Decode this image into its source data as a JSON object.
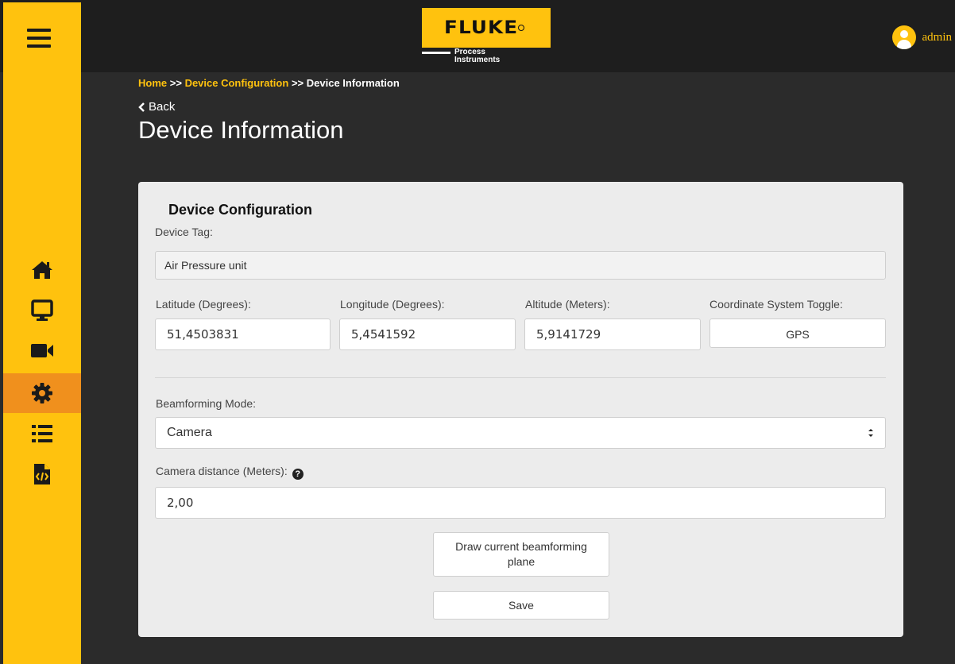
{
  "header": {
    "logo_text": "FLUKE",
    "logo_sub_line1": "Process",
    "logo_sub_line2": "Instruments",
    "user_name": "admin"
  },
  "sidebar": {
    "items": [
      {
        "icon": "home-icon"
      },
      {
        "icon": "monitor-icon"
      },
      {
        "icon": "video-camera-icon"
      },
      {
        "icon": "gear-icon",
        "active": true
      },
      {
        "icon": "list-icon"
      },
      {
        "icon": "code-file-icon"
      }
    ],
    "accent": "#ffc20e",
    "active_color": "#f0901d"
  },
  "breadcrumb": {
    "home": "Home",
    "sep1": ">>",
    "device_configuration": "Device Configuration",
    "sep2": ">>",
    "current": "Device Information"
  },
  "back_label": "Back",
  "page_title": "Device Information",
  "card": {
    "title": "Device Configuration",
    "device_tag_label": "Device Tag:",
    "device_tag_value": "Air Pressure unit",
    "latitude_label": "Latitude (Degrees):",
    "latitude_value": "51,4503831",
    "longitude_label": "Longitude (Degrees):",
    "longitude_value": "5,4541592",
    "altitude_label": "Altitude (Meters):",
    "altitude_value": "5,9141729",
    "coord_toggle_label": "Coordinate System Toggle:",
    "coord_toggle_value": "GPS",
    "beamforming_label": "Beamforming Mode:",
    "beamforming_value": "Camera",
    "camera_distance_label": "Camera distance (Meters):",
    "camera_distance_value": "2,00",
    "draw_button_label": "Draw current beamforming plane",
    "save_button_label": "Save"
  }
}
